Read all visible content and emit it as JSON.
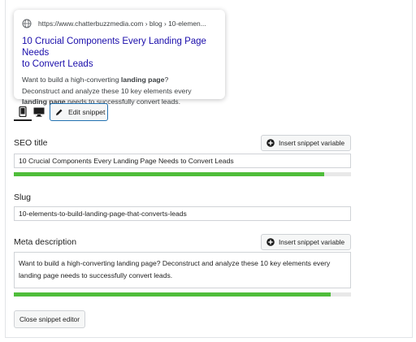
{
  "preview": {
    "url": "https://www.chatterbuzzmedia.com › blog › 10-elemen...",
    "title_line1": "10 Crucial Components Every Landing Page Needs",
    "title_line2": "to Convert Leads",
    "desc_part1": "Want to build a high-converting ",
    "desc_bold1": "landing page",
    "desc_part2": "?",
    "desc_line2": "Deconstruct and analyze these 10 key elements every",
    "desc_bold2": "landing page",
    "desc_part3": " needs to successfully convert leads."
  },
  "modes": {
    "mobile_icon": "mobile-icon",
    "desktop_icon": "desktop-icon",
    "edit_label": "Edit snippet"
  },
  "seo_title": {
    "label": "SEO title",
    "insert_label": "Insert snippet variable",
    "value": "10 Crucial Components Every Landing Page Needs to Convert Leads",
    "progress": 0.92
  },
  "slug": {
    "label": "Slug",
    "value": "10-elements-to-build-landing-page-that-converts-leads"
  },
  "meta_description": {
    "label": "Meta description",
    "insert_label": "Insert snippet variable",
    "value": "Want to build a high-converting landing page? Deconstruct and analyze these 10 key elements every landing page needs to successfully convert leads.",
    "progress": 0.94
  },
  "close_label": "Close snippet editor",
  "colors": {
    "link": "#1a0dab",
    "progress_good": "#4fbd3a",
    "accent": "#2271b1"
  }
}
